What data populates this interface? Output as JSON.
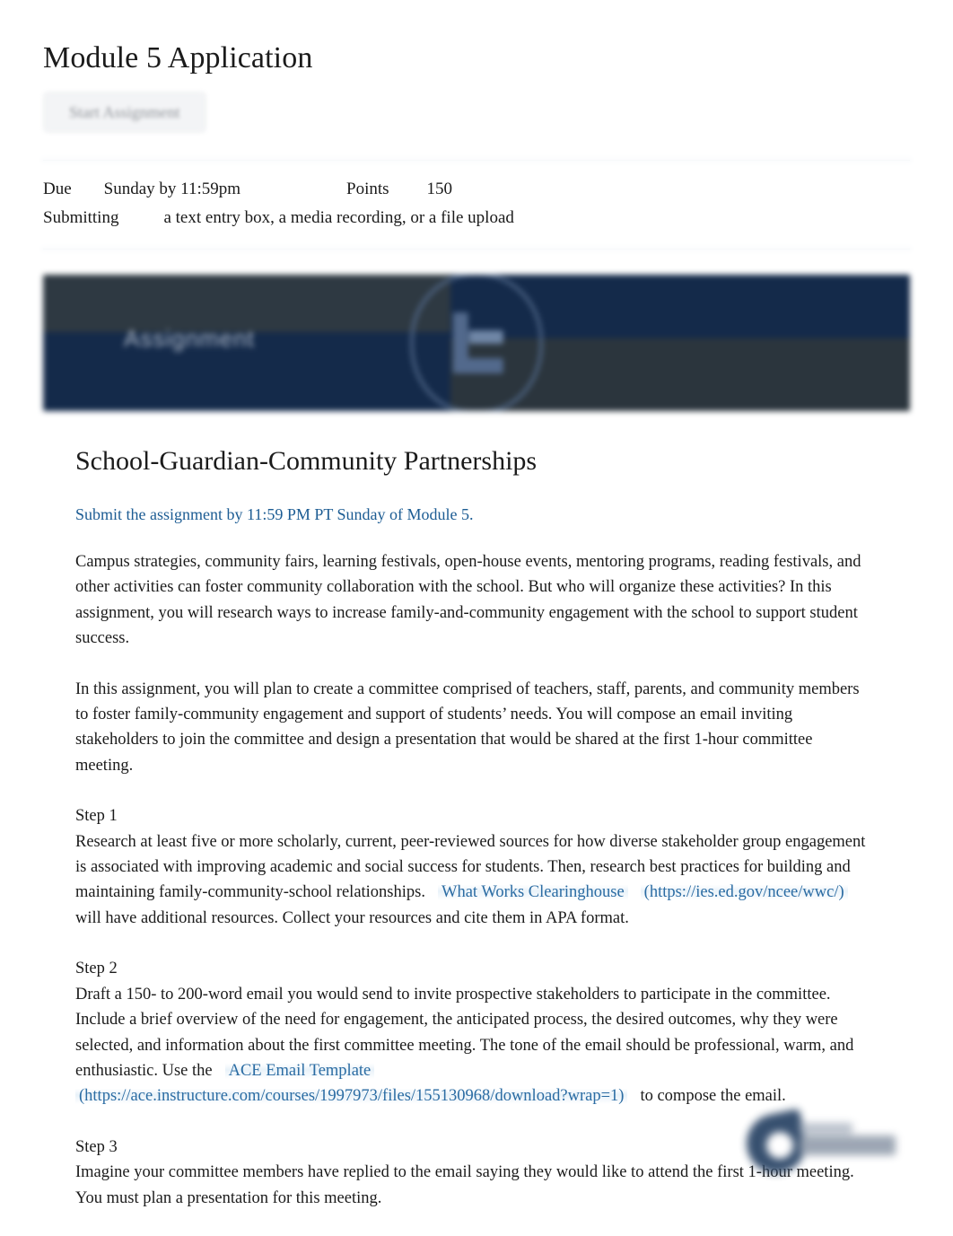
{
  "header": {
    "title": "Module 5 Application",
    "start_button_label": "Start Assignment"
  },
  "meta": {
    "due_label": "Due",
    "due_value": "Sunday by 11:59pm",
    "points_label": "Points",
    "points_value": "150",
    "submitting_label": "Submitting",
    "submitting_value": "a text entry box, a media recording, or a file upload"
  },
  "banner": {
    "text": "Assignment",
    "bg_color": "#142a4a",
    "accent_color": "#2e3942",
    "logo_color": "#52698c"
  },
  "content": {
    "title": "School-Guardian-Community Partnerships",
    "subtitle": "Submit the assignment by 11:59 PM PT Sunday of Module 5.",
    "paragraph_1": "Campus strategies, community fairs, learning festivals, open-house events, mentoring programs, reading festivals, and other activities can foster community collaboration with the school. But who will organize these activities? In this assignment, you will research ways to increase family-and-community engagement with the school to support student success.",
    "paragraph_2": "In this assignment, you will plan to create a committee comprised of teachers, staff, parents, and community members to foster family-community engagement and support of students’ needs. You will compose an email inviting stakeholders to join the committee and design a presentation that would be shared at the first 1-hour committee meeting.",
    "steps": [
      {
        "heading": "Step 1",
        "text_before_link": "Research at least five or more scholarly, current, peer-reviewed sources for how diverse stakeholder group engagement is associated with improving academic and social success for students. Then, research best practices for building and maintaining family-community-school relationships.",
        "link_text": "What Works Clearinghouse",
        "link_url": "(https://ies.ed.gov/ncee/wwc/)",
        "text_after_link": "will have additional resources. Collect your resources and cite them in APA format."
      },
      {
        "heading": "Step 2",
        "text_before_link": "Draft a 150- to 200-word email you would send to invite prospective stakeholders to participate in the committee. Include a brief overview of the need for engagement, the anticipated process, the desired outcomes, why they were selected, and information about the first committee meeting. The tone of the email should be professional, warm, and enthusiastic. Use the",
        "link_text": "ACE Email Template",
        "link_url": "(https://ace.instructure.com/courses/1997973/files/155130968/download?wrap=1)",
        "text_after_link": "to compose the email."
      },
      {
        "heading": "Step 3",
        "text_before_link": "Imagine your committee members have replied to the email saying they would like to attend the first 1-hour meeting. You must plan a presentation for this meeting.",
        "link_text": "",
        "link_url": "",
        "text_after_link": ""
      }
    ]
  },
  "colors": {
    "link_blue": "#2b6ca3",
    "subtitle_blue": "#1c5c93",
    "text_black": "#1b1b1b",
    "banner_navy": "#142a4a"
  }
}
